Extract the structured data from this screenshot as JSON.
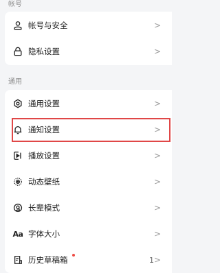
{
  "account_section": {
    "title": "帐号",
    "items": [
      {
        "label": "帐号与安全",
        "icon": "person-icon"
      },
      {
        "label": "隐私设置",
        "icon": "lock-icon"
      }
    ]
  },
  "general_section": {
    "title": "通用",
    "items": [
      {
        "label": "通用设置",
        "icon": "gear-icon"
      },
      {
        "label": "通知设置",
        "icon": "bell-icon"
      },
      {
        "label": "播放设置",
        "icon": "play-settings-icon"
      },
      {
        "label": "动态壁纸",
        "icon": "wallpaper-icon"
      },
      {
        "label": "长辈模式",
        "icon": "elder-mode-icon"
      },
      {
        "label": "字体大小",
        "icon": "font-size-icon",
        "glyph": "Aa"
      },
      {
        "label": "历史草稿箱",
        "icon": "drafts-icon",
        "count": "1"
      }
    ]
  },
  "chevron": ">",
  "colors": {
    "highlight": "#e04747",
    "badge_dot": "#ee4c45"
  }
}
